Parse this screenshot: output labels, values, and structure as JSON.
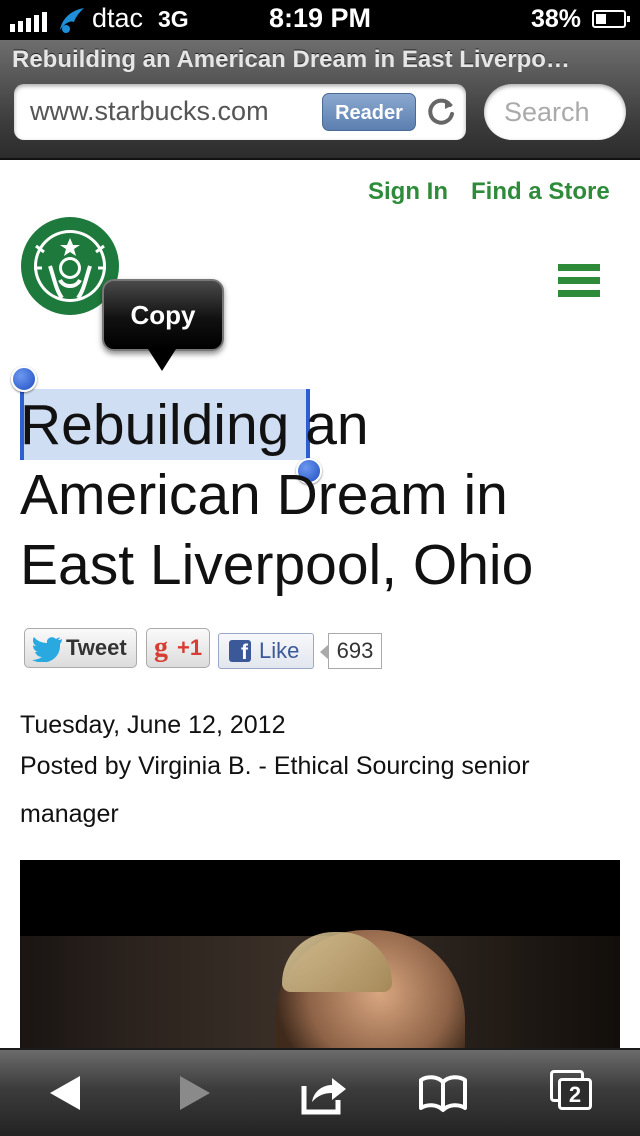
{
  "status_bar": {
    "carrier": "dtac",
    "network": "3G",
    "time": "8:19 PM",
    "battery_percent_label": "38%",
    "battery_level": 0.38,
    "signal_bars": 5
  },
  "browser": {
    "page_title": "Rebuilding an American Dream in East Liverpo…",
    "url": "www.starbucks.com",
    "reader_label": "Reader",
    "search_placeholder": "Search"
  },
  "site": {
    "sign_in": "Sign In",
    "find_store": "Find a Store",
    "brand_color": "#2e8b3a",
    "logo_icon": "starbucks-siren-logo",
    "menu_icon": "hamburger-icon"
  },
  "selection_popup": {
    "copy_label": "Copy",
    "selected_text": "Rebuilding"
  },
  "article": {
    "title_selected": "Rebuilding",
    "title_rest": " an American Dream in East Liverpool, Ohio",
    "date": "Tuesday, June 12, 2012",
    "author_line": "Posted by Virginia B. - Ethical Sourcing senior manager"
  },
  "social": {
    "tweet_label": "Tweet",
    "gplus_label": "+1",
    "like_label": "Like",
    "like_count": "693"
  },
  "toolbar": {
    "tab_count": "2",
    "icons": [
      "back-icon",
      "forward-icon",
      "share-icon",
      "bookmarks-icon",
      "tabs-icon"
    ]
  }
}
